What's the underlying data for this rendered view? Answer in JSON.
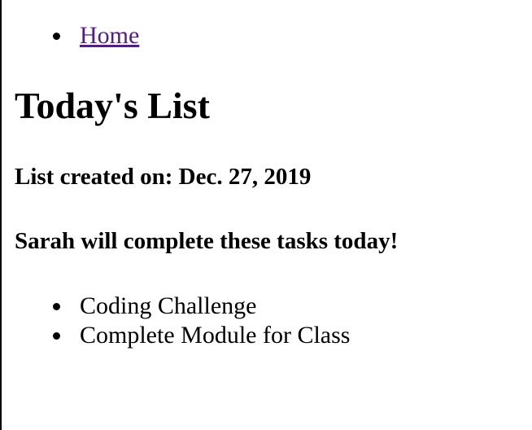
{
  "nav": {
    "items": [
      {
        "label": "Home"
      }
    ]
  },
  "main": {
    "title": "Today's List",
    "created_line": "List created on: Dec. 27, 2019",
    "subtitle": "Sarah will complete these tasks today!",
    "tasks": [
      {
        "label": "Coding Challenge"
      },
      {
        "label": "Complete Module for Class"
      }
    ]
  },
  "colors": {
    "link": "#551a8b",
    "text": "#000000",
    "background": "#ffffff"
  }
}
